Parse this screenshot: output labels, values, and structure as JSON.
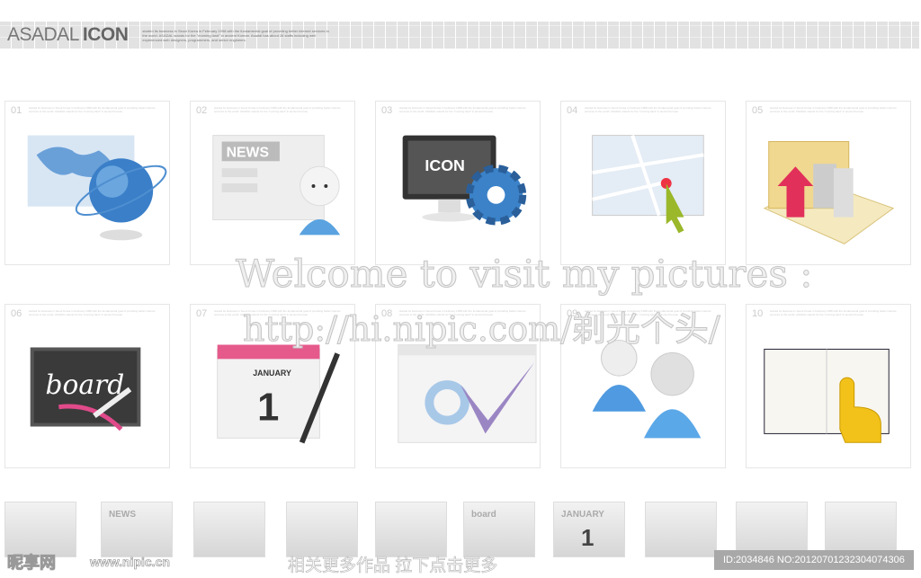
{
  "header": {
    "brand_light": "ASADAL",
    "brand_bold": "ICON",
    "description": "started its business in Seoul Korea in February 1998 with the fundamental goal of providing better internet services to the world. ASADAL stands for the \"morning land\" in ancient Korean. Asadal has about 26 staffs including well experienced web designers, programmers, and senior engineers."
  },
  "cards": [
    {
      "num": "01",
      "icon": "globe-map-icon"
    },
    {
      "num": "02",
      "icon": "news-support-icon",
      "text": "NEWS"
    },
    {
      "num": "03",
      "icon": "monitor-gear-icon",
      "text": "ICON"
    },
    {
      "num": "04",
      "icon": "map-cursor-icon"
    },
    {
      "num": "05",
      "icon": "folder-coins-icon"
    },
    {
      "num": "06",
      "icon": "chalkboard-icon",
      "text": "board"
    },
    {
      "num": "07",
      "icon": "calendar-pen-icon",
      "text": "JANUARY",
      "day": "1"
    },
    {
      "num": "08",
      "icon": "window-check-icon"
    },
    {
      "num": "09",
      "icon": "users-icon"
    },
    {
      "num": "10",
      "icon": "book-hand-icon"
    }
  ],
  "card_description": "started its business in Seoul Korea in February 1998 with the fundamental goal of providing better internet services to the world. ASADAL stands for the \"morning land\" in ancient Korean.",
  "watermark": {
    "line1": "Welcome to visit my pictures :",
    "line2": "http://hi.nipic.com/剃光个头/"
  },
  "strip": {
    "thumb_news": "NEWS",
    "thumb_board": "board",
    "thumb_january": "JANUARY",
    "thumb_day": "1"
  },
  "footer": {
    "site_cn": "昵享网",
    "site_url": "www.nipic.cn",
    "center": "相关更多作品 拉下点击更多",
    "id_text": "ID:2034846 NO:20120701232304074306"
  }
}
